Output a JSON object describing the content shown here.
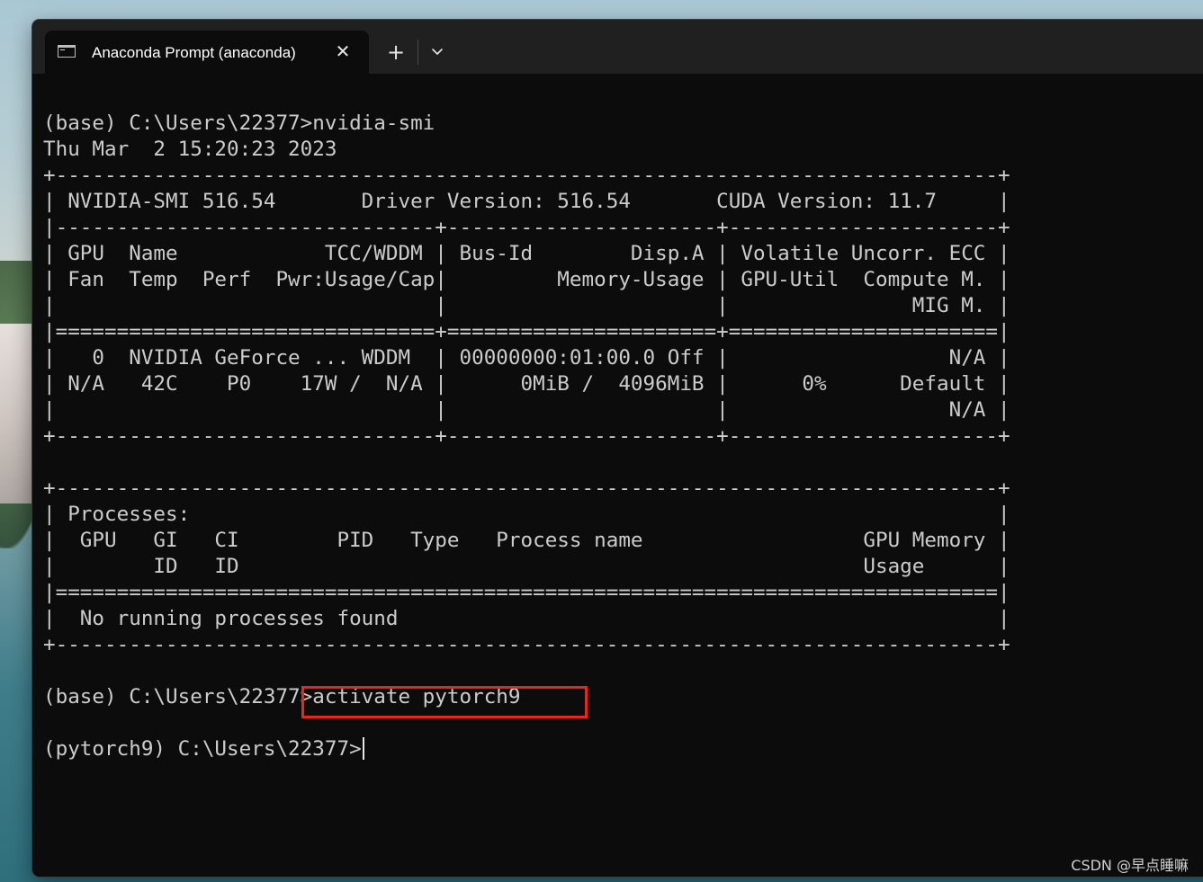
{
  "window": {
    "tab_title": "Anaconda Prompt (anaconda)",
    "tab_icon": "terminal-icon",
    "close_glyph": "✕",
    "new_tab_glyph": "+",
    "dropdown_icon": "chevron-down-icon"
  },
  "terminal": {
    "lines": [
      "(base) C:\\Users\\22377>nvidia-smi",
      "Thu Mar  2 15:20:23 2023",
      "+-----------------------------------------------------------------------------+",
      "| NVIDIA-SMI 516.54       Driver Version: 516.54       CUDA Version: 11.7     |",
      "|-------------------------------+----------------------+----------------------+",
      "| GPU  Name            TCC/WDDM | Bus-Id        Disp.A | Volatile Uncorr. ECC |",
      "| Fan  Temp  Perf  Pwr:Usage/Cap|         Memory-Usage | GPU-Util  Compute M. |",
      "|                               |                      |               MIG M. |",
      "|===============================+======================+======================|",
      "|   0  NVIDIA GeForce ... WDDM  | 00000000:01:00.0 Off |                  N/A |",
      "| N/A   42C    P0    17W /  N/A |      0MiB /  4096MiB |      0%      Default |",
      "|                               |                      |                  N/A |",
      "+-------------------------------+----------------------+----------------------+",
      "",
      "+-----------------------------------------------------------------------------+",
      "| Processes:                                                                  |",
      "|  GPU   GI   CI        PID   Type   Process name                  GPU Memory |",
      "|        ID   ID                                                   Usage      |",
      "|=============================================================================|",
      "|  No running processes found                                                 |",
      "+-----------------------------------------------------------------------------+",
      "",
      "(base) C:\\Users\\22377>activate pytorch9",
      "",
      "(pytorch9) C:\\Users\\22377>"
    ]
  },
  "highlight": {
    "color": "#e8261b"
  },
  "watermark": "CSDN @早点睡嘛"
}
